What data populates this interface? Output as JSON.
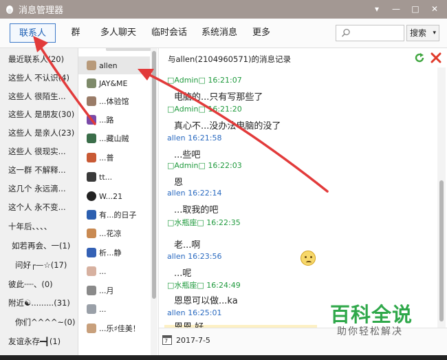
{
  "window": {
    "title": "消息管理器",
    "controls": [
      "▾",
      "—",
      "□",
      "✕"
    ]
  },
  "toolbar": {
    "tabs": [
      "联系人",
      "群",
      "多人聊天",
      "临时会话",
      "系统消息",
      "更多"
    ],
    "active_tab": "联系人",
    "search_button": "搜索",
    "search_caret": "▾"
  },
  "groups": [
    "最近联系人(20)",
    "这些人  不认识(4)",
    "这些人  很陌生...",
    "这些人  是朋友(30)",
    "这些人  是亲人(23)",
    "这些人  很现实...",
    "这一群  不解释...",
    "这几个  永远滴...",
    "这个人  永不变...",
    "十年后、、、、",
    "如若再会、一(1)",
    "问好┌—☆(17)",
    "彼此┈┈、(0)",
    "附近☯.........(31)",
    "你们^^^^~(0)",
    "友谊永存━┫(1)"
  ],
  "contacts": [
    {
      "name": "allen",
      "color": "#b89a7a"
    },
    {
      "name": "JAY&ME",
      "color": "#7e8a6a"
    },
    {
      "name": "...体验馆",
      "color": "#9a7c68"
    },
    {
      "name": "...路",
      "color": "#7a4aa8"
    },
    {
      "name": "...藏山贼",
      "color": "#3b6e4a"
    },
    {
      "name": "...普",
      "color": "#c95a35"
    },
    {
      "name": "tt...",
      "color": "#3a3a3a"
    },
    {
      "name": "W...21",
      "color": "#222222"
    },
    {
      "name": "有...的日子",
      "color": "#2c5fb0"
    },
    {
      "name": "...花凉",
      "color": "#c98a52"
    },
    {
      "name": "析...静",
      "color": "#3461b5"
    },
    {
      "name": "...",
      "color": "#d7b1a0"
    },
    {
      "name": "...月",
      "color": "#8a8a8a"
    },
    {
      "name": "...",
      "color": "#9aa0a8"
    },
    {
      "name": "...乐♯佳美！",
      "color": "#c8a07c"
    }
  ],
  "record": {
    "title": "与allen(2104960571)的消息记录",
    "messages": [
      {
        "sender": "□Admin□",
        "time": "16:21:07",
        "text": "电脑的...只有写那些了",
        "type": "admin"
      },
      {
        "sender": "□Admin□",
        "time": "16:21:20",
        "text": "真心不...没办法电脑的没了",
        "type": "admin"
      },
      {
        "sender": "allen",
        "time": "16:21:58",
        "text": "...些吧",
        "type": "allen"
      },
      {
        "sender": "□Admin□",
        "time": "16:22:03",
        "text": "恩",
        "type": "admin"
      },
      {
        "sender": "allen",
        "time": "16:22:14",
        "text": "...取我的吧",
        "type": "allen"
      },
      {
        "sender": "□水瓶座□",
        "time": "16:22:35",
        "text": "老...啊",
        "type": "admin"
      },
      {
        "sender": "allen",
        "time": "16:23:56",
        "text": "...呢",
        "type": "allen"
      },
      {
        "sender": "□水瓶座□",
        "time": "16:24:49",
        "text": "恩恩可以做...ka",
        "type": "admin"
      },
      {
        "sender": "allen",
        "time": "16:25:01",
        "text": "恩恩 好",
        "type": "allen"
      }
    ],
    "date": "2017-7-5",
    "calendar_day": "7"
  },
  "watermark": {
    "main": "百科全说",
    "sub": "助你轻松解决"
  },
  "colors": {
    "titlebar": "#a39893",
    "tab_active_border": "#3c78c8",
    "admin_green": "#1f9a3d",
    "allen_blue": "#2a6ac0",
    "arrow_red": "#e23b3b",
    "watermark_green": "#2fa84a"
  }
}
